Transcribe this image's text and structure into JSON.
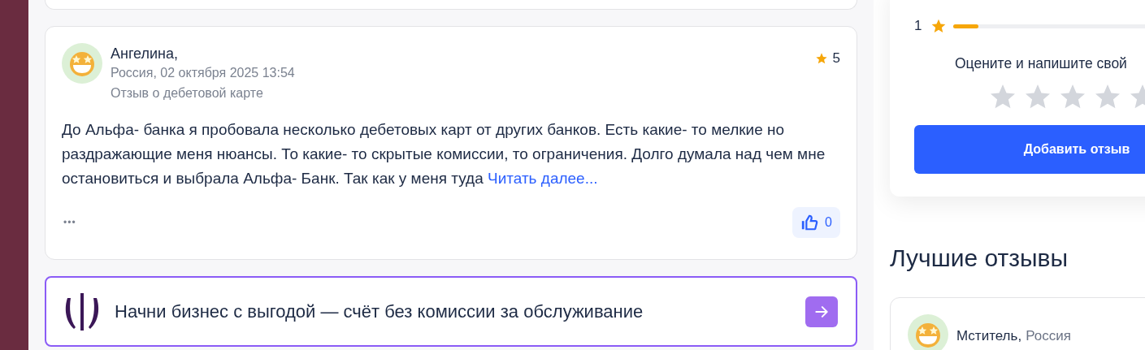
{
  "review": {
    "author": "Ангелина,",
    "meta": "Россия, 02 октября 2025 13:54",
    "subject": "Отзыв о дебетовой карте",
    "rating": "5",
    "text": "До Альфа- банка я пробовала несколько дебетовых карт от других банков. Есть какие- то мелкие но раздражающие меня нюансы. То какие- то скрытые комиссии, то ограничения. Долго думала над чем мне остановиться и выбрала Альфа- Банк. Так как у меня туда",
    "read_more": "Читать далее...",
    "more": "•••",
    "likes": "0"
  },
  "promo": {
    "text": "Начни бизнес с выгодой — счёт без комиссии за обслуживание"
  },
  "rating_summary": {
    "rows": [
      {
        "label": "1",
        "level": 0.09
      }
    ],
    "prompt": "Оцените и напишите свой",
    "stars": 0,
    "button": "Добавить отзыв"
  },
  "best_reviews": {
    "title": "Лучшие отзывы",
    "items": [
      {
        "author": "Мститель,",
        "country": "Россия"
      }
    ]
  }
}
